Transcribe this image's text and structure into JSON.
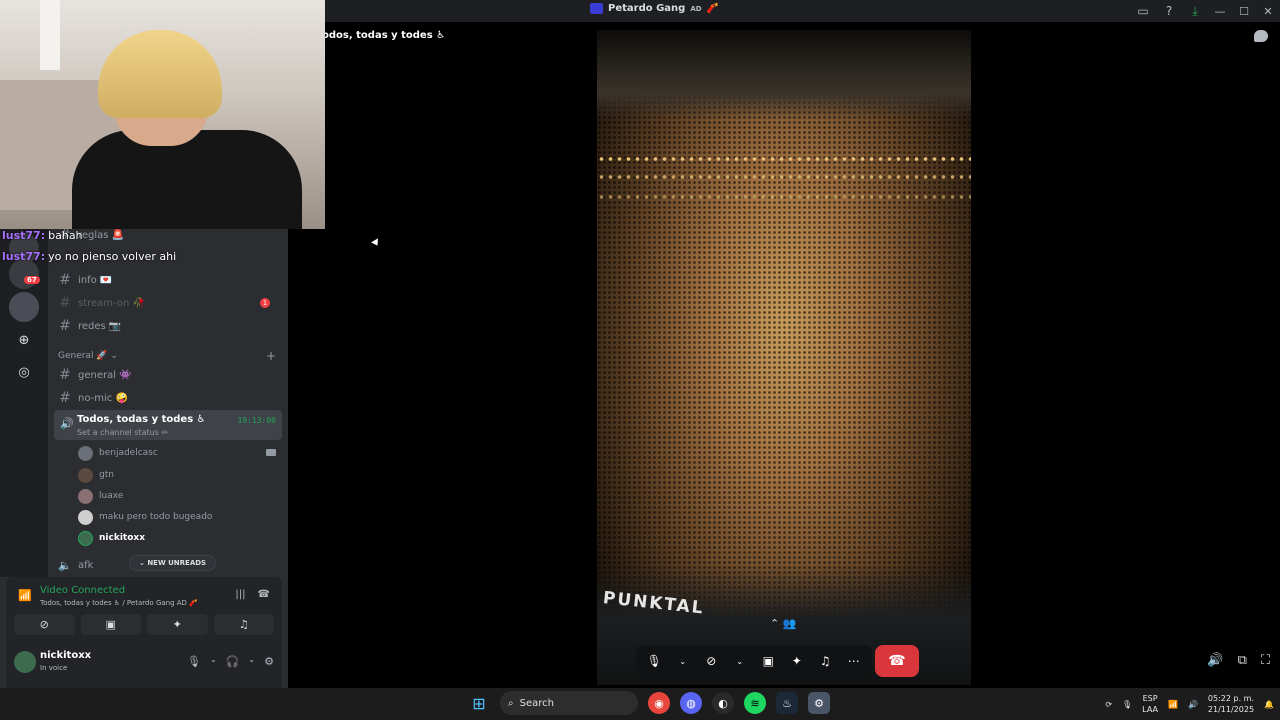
{
  "titlebar": {
    "server_name": "Petardo Gang",
    "server_suffix": "AD",
    "icons": [
      "inbox-icon",
      "help-icon",
      "download-icon",
      "minimize-icon",
      "maximize-icon",
      "close-icon"
    ]
  },
  "stage": {
    "channel_title": "odos, todas y todes ♿",
    "video_text": "PUNKTAL"
  },
  "overlay_chat": [
    {
      "user": "lust77:",
      "text": "bahah"
    },
    {
      "user": "lust77:",
      "text": "yo no pienso volver ahi"
    }
  ],
  "rail": {
    "badge": "67"
  },
  "channels": [
    {
      "name": "reglas 🚨",
      "muted": false
    },
    {
      "name": "info 💌",
      "muted": false
    },
    {
      "name": "stream-on 🥀",
      "muted": true,
      "unread": "1"
    },
    {
      "name": "redes 📷",
      "muted": false
    }
  ],
  "category": {
    "label": "General 🚀"
  },
  "general_channels": [
    {
      "name": "general 👾"
    },
    {
      "name": "no-mic 🤪"
    }
  ],
  "voice_channel": {
    "name": "Todos, todas y todes ♿",
    "status": "Set a channel status ✏",
    "timer": "19:13:00"
  },
  "members": [
    {
      "name": "benjadelcasc"
    },
    {
      "name": "gtn"
    },
    {
      "name": "luaxe"
    },
    {
      "name": "maku pero todo bugeado"
    },
    {
      "name": "nickitoxx"
    }
  ],
  "afk_channel": "afk",
  "new_unreads": "NEW UNREADS",
  "voice_panel": {
    "title": "Video Connected",
    "subtitle": "Todos, todas y todes ♿ / Petardo Gang AD 🧨"
  },
  "user": {
    "name": "nickitoxx",
    "status": "In voice"
  },
  "taskbar": {
    "search_label": "Search",
    "lang_top": "ESP",
    "lang_bottom": "LAA",
    "time": "05:22 p. m.",
    "date": "21/11/2025"
  },
  "colors": {
    "accent_green": "#23a55a",
    "hangup_red": "#da373c",
    "sidebar_bg": "#2b2d31",
    "rail_bg": "#1e1f22"
  }
}
